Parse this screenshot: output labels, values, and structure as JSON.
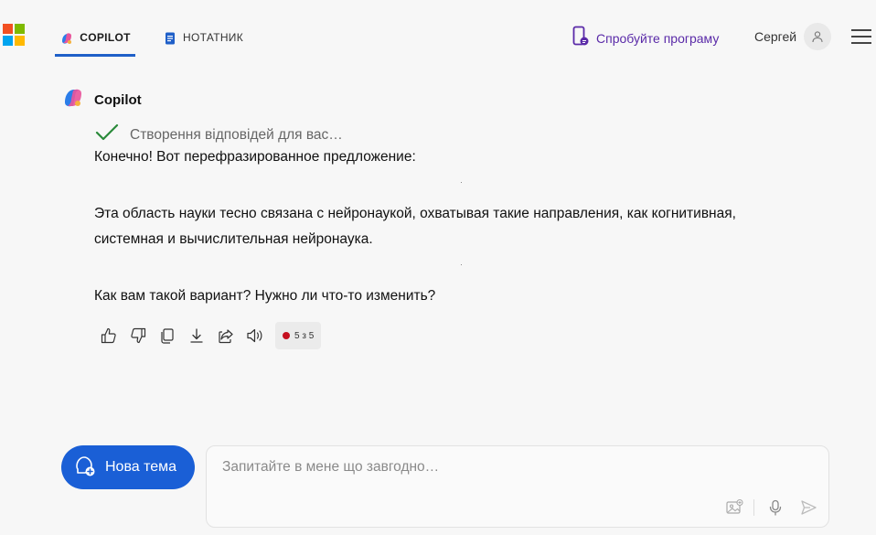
{
  "header": {
    "tabs": [
      {
        "label": "COPILOT",
        "active": true
      },
      {
        "label": "НОТАТНИК",
        "active": false
      }
    ],
    "try_app_label": "Спробуйте програму",
    "user_name": "Сергей"
  },
  "message": {
    "sender": "Copilot",
    "status": "Створення відповідей для вас…",
    "paragraphs": [
      "Конечно! Вот перефразированное предложение:",
      "Эта область науки тесно связана с нейронаукой, охватывая такие направления, как когнитивная, системная и вычислительная нейронаука.",
      "Как вам такой вариант? Нужно ли что-то изменить?"
    ],
    "counter": "5 з 5"
  },
  "actions": [
    "thumbs-up-icon",
    "thumbs-down-icon",
    "copy-icon",
    "download-icon",
    "share-icon",
    "speaker-icon"
  ],
  "composer": {
    "new_topic_label": "Нова тема",
    "placeholder": "Запитайте в мене що завгодно…"
  },
  "colors": {
    "accent": "#1a5fd6",
    "try_app": "#5a2aa8",
    "check": "#2a8a3a",
    "counter_dot": "#c50f1f"
  }
}
